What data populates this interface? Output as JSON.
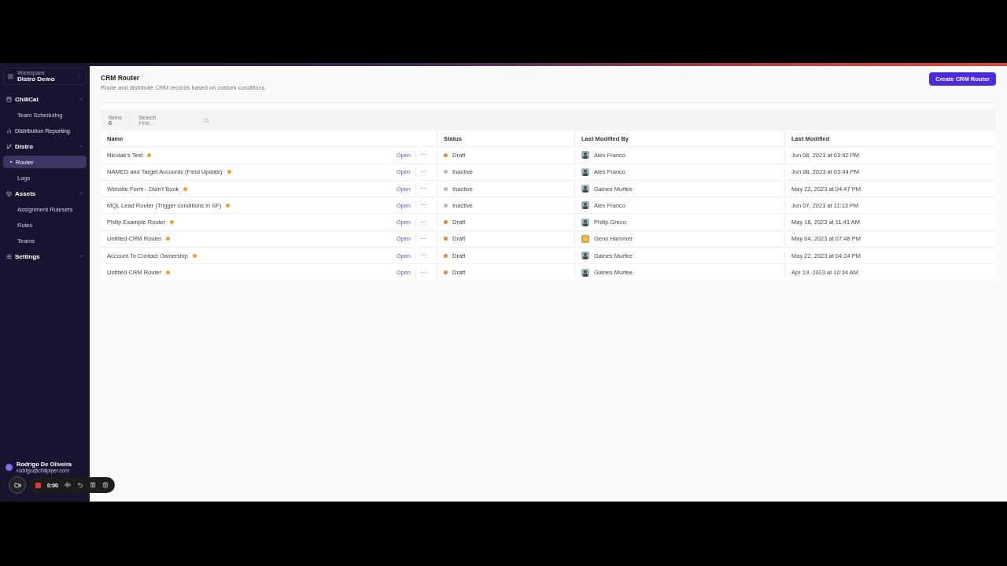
{
  "sidebar": {
    "workspace": {
      "label": "Workspace",
      "name": "Distro Demo"
    },
    "sections": [
      {
        "title": "ChiliCal",
        "expanded": true,
        "items": [
          {
            "label": "Team Scheduling",
            "selected": false
          }
        ]
      },
      {
        "title": "Distribution Reporting",
        "kind": "link"
      },
      {
        "title": "Distro",
        "expanded": true,
        "items": [
          {
            "label": "Router",
            "selected": true
          },
          {
            "label": "Logs",
            "selected": false
          }
        ]
      },
      {
        "title": "Assets",
        "expanded": true,
        "items": [
          {
            "label": "Assignment Rulesets",
            "selected": false
          },
          {
            "label": "Rules",
            "selected": false
          },
          {
            "label": "Teams",
            "selected": false
          }
        ]
      },
      {
        "title": "Settings",
        "expanded": false
      }
    ],
    "user": {
      "name": "Rodrigo De Oliveira",
      "email": "rodrigo@chilipiper.com"
    }
  },
  "page": {
    "title": "CRM Router",
    "subtitle": "Route and distribute CRM records based on custom conditions.",
    "create_button": "Create CRM Router"
  },
  "toolbar": {
    "items_label": "Items",
    "items_count": "8",
    "search_label": "Search",
    "search_placeholder": "Find..."
  },
  "table": {
    "columns": [
      "Name",
      "Status",
      "Last Modified By",
      "Last Modified"
    ],
    "rows": [
      {
        "name": "Nicolas's Test",
        "open": "Open",
        "more": "···",
        "status": "Draft",
        "color": "#e8893a",
        "user": "Alex Franco",
        "modified": "Jun 08, 2023 at 03:42 PM"
      },
      {
        "name": "NAMED and Target Accounts (Field Update)",
        "open": "Open",
        "more": "···",
        "status": "Inactive",
        "color": "#b8b8c0",
        "user": "Alex Franco",
        "modified": "Jun 08, 2023 at 03:44 PM"
      },
      {
        "name": "Website Form - Didn't Book",
        "open": "Open",
        "more": "···",
        "status": "Inactive",
        "color": "#b8b8c0",
        "user": "Gaines Murfee",
        "modified": "May 22, 2023 at 04:47 PM"
      },
      {
        "name": "MQL Lead Router (Trigger conditions in SF)",
        "open": "Open",
        "more": "···",
        "status": "Inactive",
        "color": "#b8b8c0",
        "user": "Alex Franco",
        "modified": "Jun 07, 2023 at 11:13 PM"
      },
      {
        "name": "Philip Example Router",
        "open": "Open",
        "more": "···",
        "status": "Draft",
        "color": "#e8893a",
        "user": "Philip Greco",
        "modified": "May 16, 2023 at 11:41 AM"
      },
      {
        "name": "Untitled CRM Router",
        "open": "Open",
        "more": "···",
        "status": "Draft",
        "color": "#e8893a",
        "user": "Geno Hammer",
        "initial": "G",
        "modified": "May 04, 2023 at 07:48 PM"
      },
      {
        "name": "Account To Contact Ownership",
        "open": "Open",
        "more": "···",
        "status": "Draft",
        "color": "#e8893a",
        "user": "Gaines Murfee",
        "modified": "May 22, 2023 at 04:24 PM"
      },
      {
        "name": "Untitled CRM Router",
        "open": "Open",
        "more": "···",
        "status": "Draft",
        "color": "#e8893a",
        "user": "Gaines Murfee",
        "modified": "Apr 19, 2023 at 10:34 AM"
      }
    ]
  },
  "recorder": {
    "time": "0:00"
  }
}
